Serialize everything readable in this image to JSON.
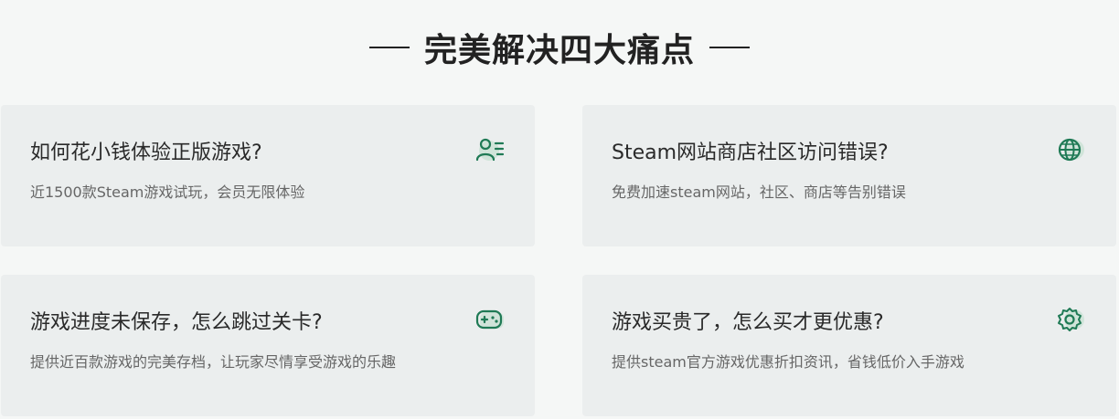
{
  "section": {
    "title": "完美解决四大痛点"
  },
  "cards": [
    {
      "title": "如何花小钱体验正版游戏?",
      "description": "近1500款Steam游戏试玩，会员无限体验",
      "icon": "user-list-icon"
    },
    {
      "title": "Steam网站商店社区访问错误?",
      "description": "免费加速steam网站，社区、商店等告别错误",
      "icon": "globe-icon"
    },
    {
      "title": "游戏进度未保存，怎么跳过关卡?",
      "description": "提供近百款游戏的完美存档，让玩家尽情享受游戏的乐趣",
      "icon": "gamepad-icon"
    },
    {
      "title": "游戏买贵了，怎么买才更优惠?",
      "description": "提供steam官方游戏优惠折扣资讯，省钱低价入手游戏",
      "icon": "gear-icon"
    }
  ],
  "colors": {
    "accent": "#1f7a55",
    "accent_shadow": "#b9dcc9",
    "card_bg": "#ebeeee",
    "page_bg": "#f5f7f6"
  }
}
